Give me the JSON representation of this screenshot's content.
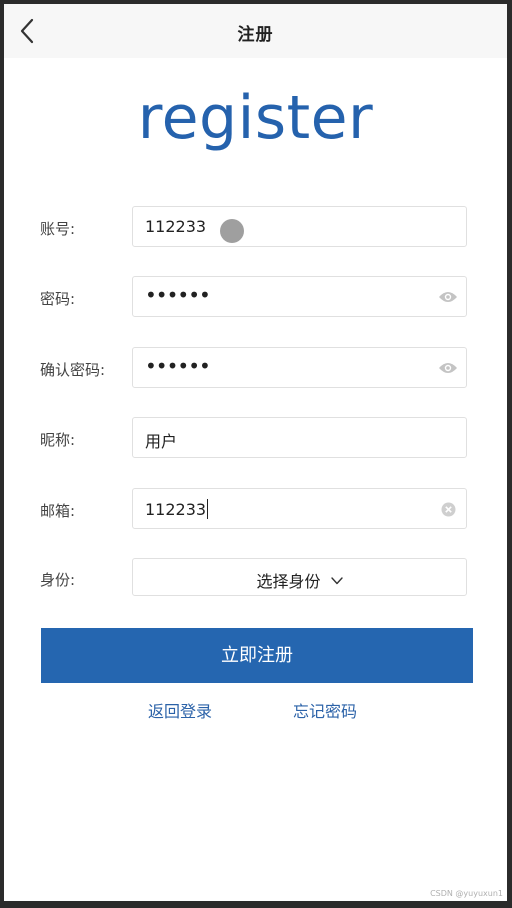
{
  "navbar": {
    "title": "注册",
    "back_icon": "chevron-left-icon"
  },
  "logo": {
    "text": "register",
    "color": "#2562ad"
  },
  "form": {
    "account": {
      "label": "账号:",
      "value": "112233"
    },
    "password": {
      "label": "密码:",
      "value": "••••••",
      "icon": "eye-icon"
    },
    "confirm_password": {
      "label": "确认密码:",
      "value": "••••••",
      "icon": "eye-icon"
    },
    "nickname": {
      "label": "昵称:",
      "value": "用户"
    },
    "email": {
      "label": "邮箱:",
      "value": "112233",
      "icon": "clear-icon"
    },
    "identity": {
      "label": "身份:",
      "value": "选择身份",
      "icon": "chevron-down-icon"
    }
  },
  "actions": {
    "submit_label": "立即注册",
    "back_to_login": "返回登录",
    "forgot_password": "忘记密码"
  },
  "watermark": "CSDN @yuyuxun1",
  "colors": {
    "primary": "#2566b0",
    "link": "#2b62a8",
    "border": "#e0e0e0"
  }
}
